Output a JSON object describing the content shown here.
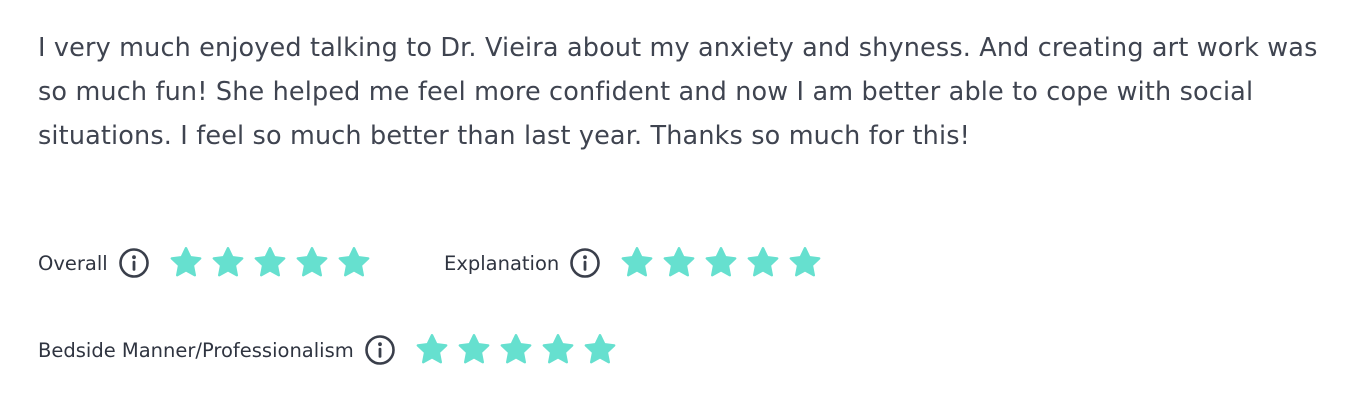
{
  "review": {
    "text": "I very much enjoyed talking to Dr. Vieira about my anxiety and shyness. And creating art work was so much fun! She helped me feel more confident and now I am better able to cope with social situations. I feel so much better than last year. Thanks so much for this!"
  },
  "ratings": {
    "overall": {
      "label": "Overall",
      "stars": 5,
      "max": 5
    },
    "explanation": {
      "label": "Explanation",
      "stars": 5,
      "max": 5
    },
    "bedside": {
      "label": "Bedside Manner/Professionalism",
      "stars": 5,
      "max": 5
    }
  },
  "colors": {
    "star": "#66e0cf",
    "text": "#3f4450",
    "icon": "#3a3f4b"
  },
  "icons": {
    "info": "info-circle-icon",
    "star": "star-icon"
  }
}
